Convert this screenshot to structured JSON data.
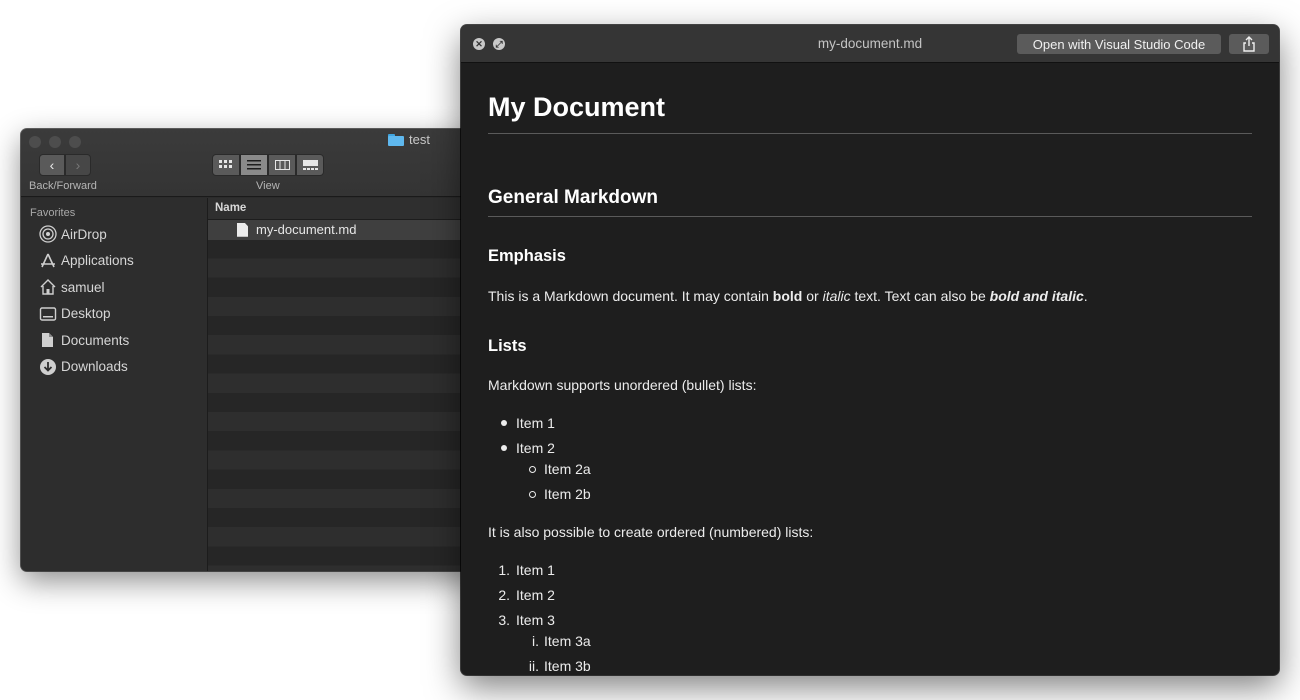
{
  "finder": {
    "title": "test",
    "nav_label": "Back/Forward",
    "view_label": "View",
    "back_glyph": "‹",
    "forward_glyph": "›",
    "sidebar": {
      "header": "Favorites",
      "items": [
        {
          "label": "AirDrop",
          "icon": "airdrop-icon"
        },
        {
          "label": "Applications",
          "icon": "applications-icon"
        },
        {
          "label": "samuel",
          "icon": "home-icon"
        },
        {
          "label": "Desktop",
          "icon": "desktop-icon"
        },
        {
          "label": "Documents",
          "icon": "documents-icon"
        },
        {
          "label": "Downloads",
          "icon": "downloads-icon"
        }
      ]
    },
    "column_header": "Name",
    "files": [
      {
        "name": "my-document.md",
        "selected": true
      }
    ]
  },
  "quicklook": {
    "title": "my-document.md",
    "open_button": "Open with Visual Studio Code",
    "document": {
      "h1": "My Document",
      "h2": "General Markdown",
      "emphasis_heading": "Emphasis",
      "emphasis_p": {
        "t1": "This is a Markdown document. It may contain ",
        "bold": "bold",
        "t2": " or ",
        "italic": "italic",
        "t3": " text. Text can also be ",
        "bold_italic": "bold and italic",
        "t4": "."
      },
      "lists_heading": "Lists",
      "unordered_intro": "Markdown supports unordered (bullet) lists:",
      "unordered": {
        "item1": "Item 1",
        "item2": "Item 2",
        "item2a": "Item 2a",
        "item2b": "Item 2b"
      },
      "ordered_intro": "It is also possible to create ordered (numbered) lists:",
      "ordered": {
        "n1": "1.",
        "item1": "Item 1",
        "n2": "2.",
        "item2": "Item 2",
        "n3": "3.",
        "item3": "Item 3",
        "ni": "i.",
        "item3a": "Item 3a",
        "nii": "ii.",
        "item3b": "Item 3b"
      }
    }
  },
  "colors": {
    "window_bg": "#1e1e1e",
    "finder_bg": "#2b2b2b",
    "folder_blue": "#5fb8ee",
    "text": "#ececec"
  }
}
